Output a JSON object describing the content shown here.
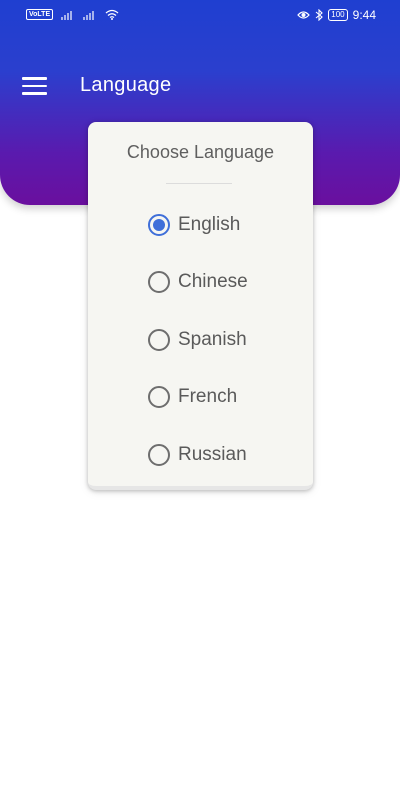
{
  "status_bar": {
    "volte": "VoLTE",
    "battery": "100",
    "time": "9:44"
  },
  "app_bar": {
    "title": "Language",
    "menu_icon": "hamburger-menu-icon"
  },
  "dialog": {
    "title": "Choose Language",
    "options": [
      {
        "label": "English",
        "selected": true
      },
      {
        "label": "Chinese",
        "selected": false
      },
      {
        "label": "Spanish",
        "selected": false
      },
      {
        "label": "French",
        "selected": false
      },
      {
        "label": "Russian",
        "selected": false
      }
    ]
  },
  "colors": {
    "header_gradient_top": "#1f3fd0",
    "header_gradient_bottom": "#6a0f9e",
    "radio_selected": "#3f6fd9",
    "card_background": "#f6f6f2"
  }
}
